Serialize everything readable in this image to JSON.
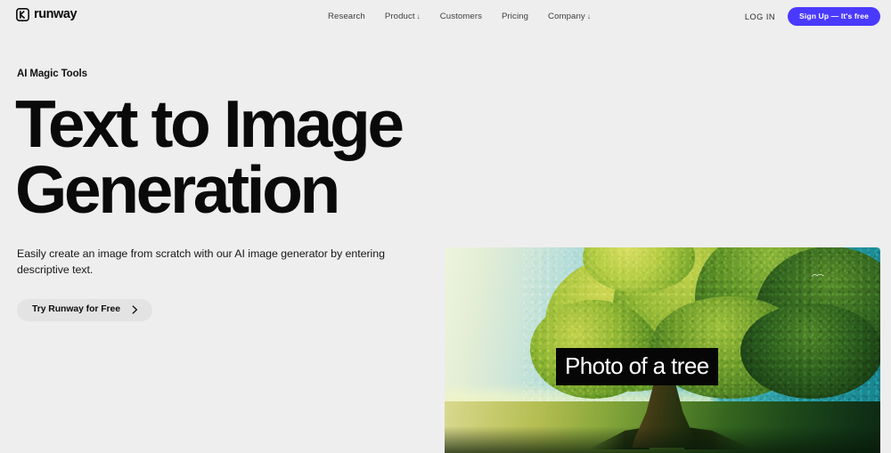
{
  "theme": {
    "page_bg": "#eeeeee",
    "accent": "#4a3aff",
    "text": "#0a0a0a",
    "button_bg": "#e3e3e3"
  },
  "header": {
    "logo": {
      "icon": "runway-logo-mark",
      "text": "runway"
    },
    "nav": [
      {
        "label": "Research",
        "caret": ""
      },
      {
        "label": "Product",
        "caret": "↓"
      },
      {
        "label": "Customers",
        "caret": ""
      },
      {
        "label": "Pricing",
        "caret": ""
      },
      {
        "label": "Company",
        "caret": "↓"
      }
    ],
    "login_label": "LOG IN",
    "signup_label": "Sign Up — It's free"
  },
  "hero": {
    "eyebrow": "AI Magic Tools",
    "headline": "Text to Image Generation",
    "subcopy": "Easily create an image from scratch with our AI image generator by entering descriptive text.",
    "cta_label": "Try Runway for Free",
    "cta_icon": "chevron-right-icon"
  },
  "media": {
    "alt": "AI generated photo of a large green tree in a field",
    "caption": "Photo of a tree",
    "colors": {
      "sky_left": "#eef4de",
      "sky_right": "#18828c",
      "canopy_light": "#cfd755",
      "canopy_dark": "#10300f",
      "ground_left": "#d9d98f",
      "ground_right": "#0d2813",
      "caption_bg": "#060606",
      "caption_text": "#ffffff"
    }
  }
}
